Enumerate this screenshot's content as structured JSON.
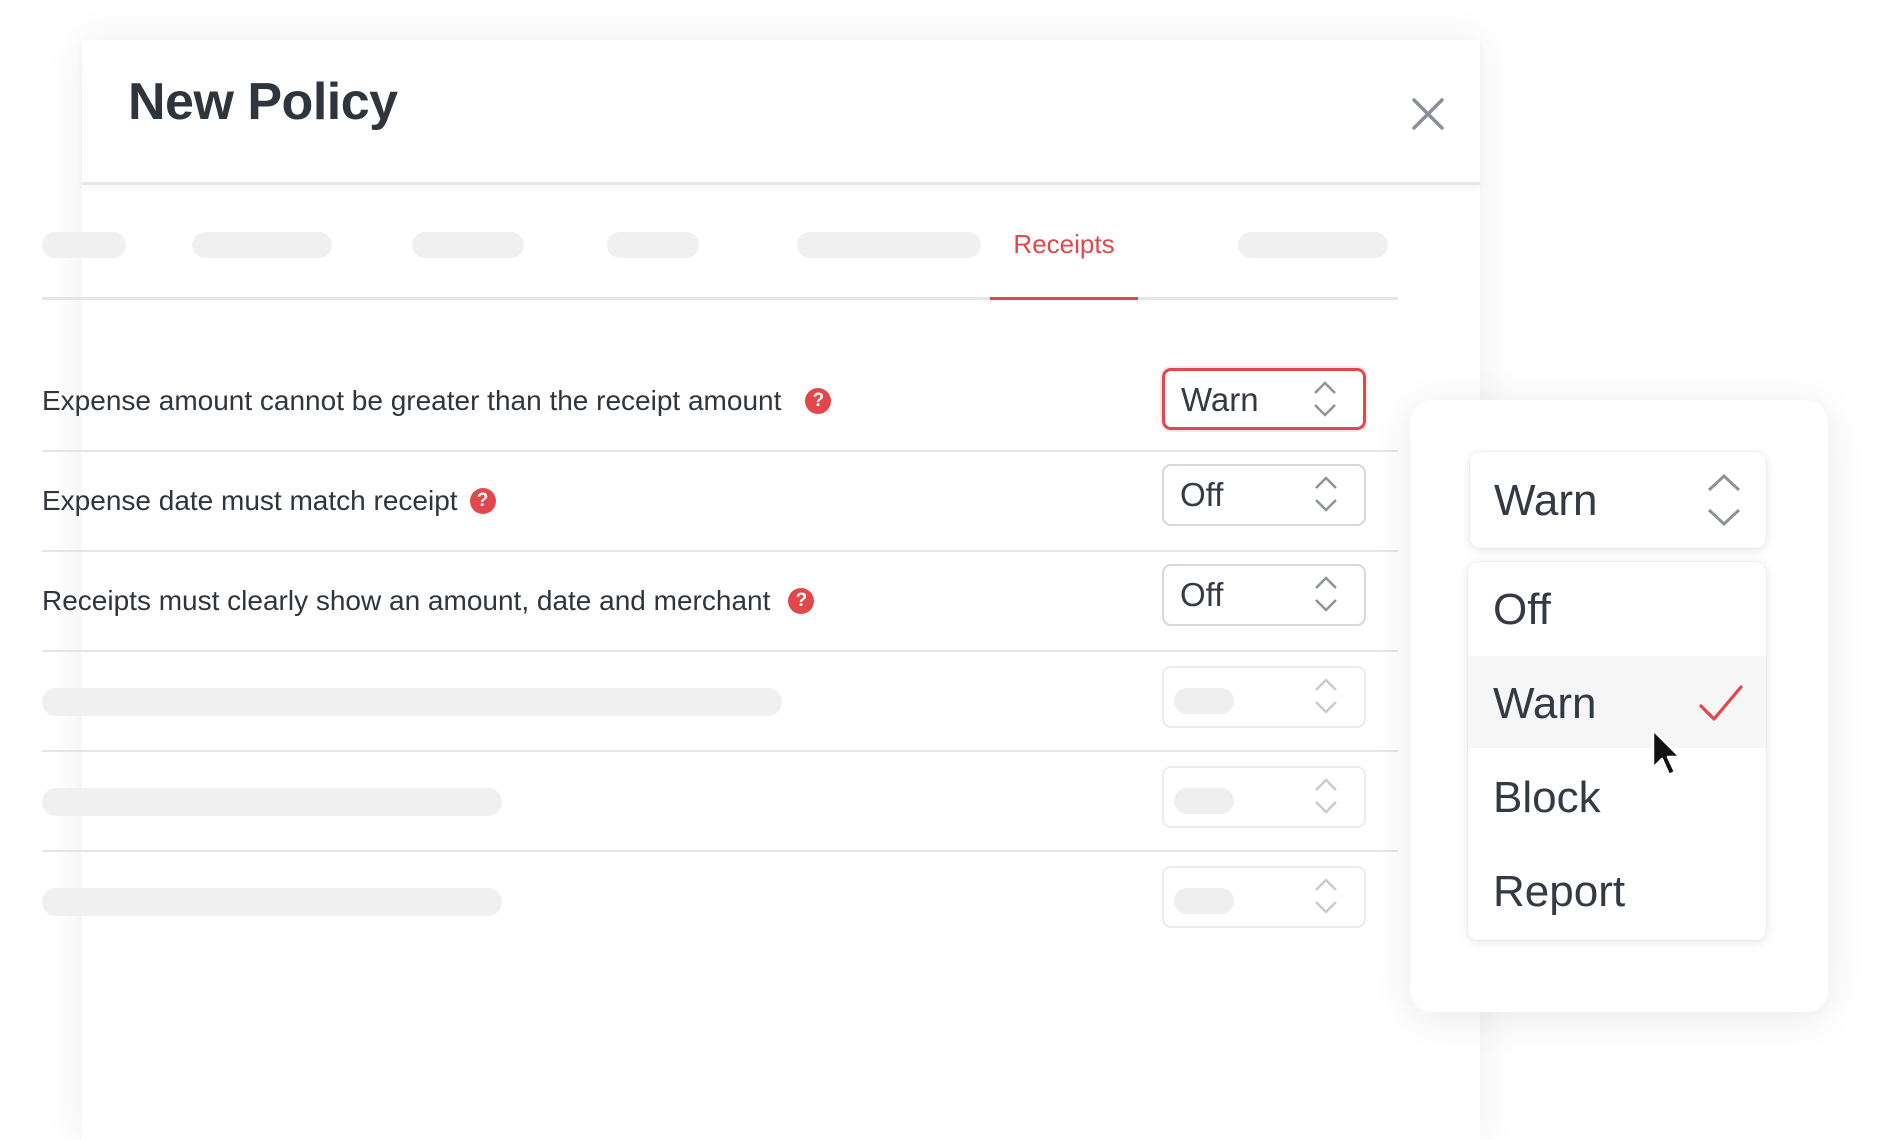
{
  "modal": {
    "title": "New Policy",
    "close_icon": "close-icon"
  },
  "tabs": {
    "active_label": "Receipts"
  },
  "rules": [
    {
      "label": "Expense amount cannot be greater than the receipt amount",
      "value": "Warn"
    },
    {
      "label": "Expense date must match receipt",
      "value": "Off"
    },
    {
      "label": "Receipts must clearly show an amount, date and merchant",
      "value": "Off"
    }
  ],
  "dropdown": {
    "current": "Warn",
    "options": [
      "Off",
      "Warn",
      "Block",
      "Report"
    ],
    "selected": "Warn"
  },
  "icons": {
    "help": "help-icon",
    "chevron": "chevron-up-down-icon",
    "check": "check-icon",
    "cursor": "mouse-pointer-icon"
  },
  "colors": {
    "accent": "#e2474c",
    "text": "#333a44",
    "placeholder": "#f0f0f0",
    "border": "#d4d7dc"
  }
}
